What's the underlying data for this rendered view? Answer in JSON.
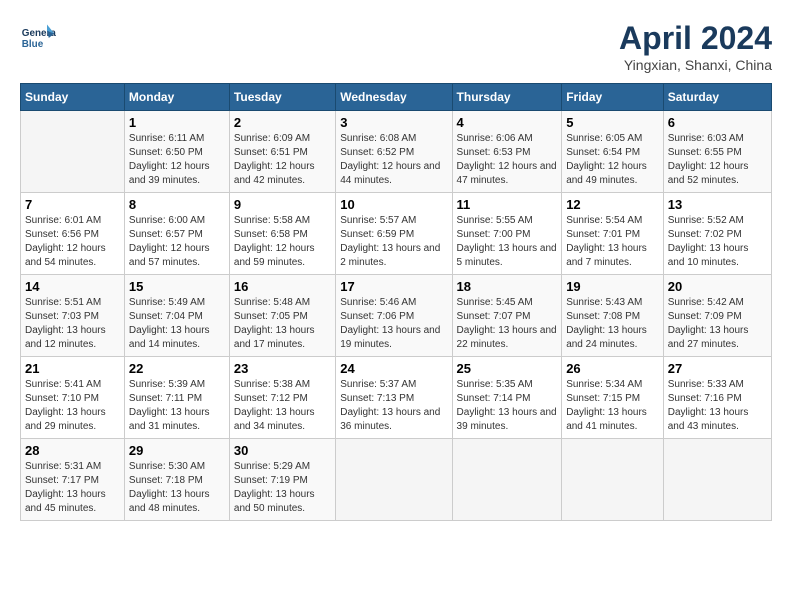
{
  "header": {
    "logo_line1": "General",
    "logo_line2": "Blue",
    "month_title": "April 2024",
    "location": "Yingxian, Shanxi, China"
  },
  "weekdays": [
    "Sunday",
    "Monday",
    "Tuesday",
    "Wednesday",
    "Thursday",
    "Friday",
    "Saturday"
  ],
  "weeks": [
    [
      {
        "day": "",
        "sunrise": "",
        "sunset": "",
        "daylight": ""
      },
      {
        "day": "1",
        "sunrise": "Sunrise: 6:11 AM",
        "sunset": "Sunset: 6:50 PM",
        "daylight": "Daylight: 12 hours and 39 minutes."
      },
      {
        "day": "2",
        "sunrise": "Sunrise: 6:09 AM",
        "sunset": "Sunset: 6:51 PM",
        "daylight": "Daylight: 12 hours and 42 minutes."
      },
      {
        "day": "3",
        "sunrise": "Sunrise: 6:08 AM",
        "sunset": "Sunset: 6:52 PM",
        "daylight": "Daylight: 12 hours and 44 minutes."
      },
      {
        "day": "4",
        "sunrise": "Sunrise: 6:06 AM",
        "sunset": "Sunset: 6:53 PM",
        "daylight": "Daylight: 12 hours and 47 minutes."
      },
      {
        "day": "5",
        "sunrise": "Sunrise: 6:05 AM",
        "sunset": "Sunset: 6:54 PM",
        "daylight": "Daylight: 12 hours and 49 minutes."
      },
      {
        "day": "6",
        "sunrise": "Sunrise: 6:03 AM",
        "sunset": "Sunset: 6:55 PM",
        "daylight": "Daylight: 12 hours and 52 minutes."
      }
    ],
    [
      {
        "day": "7",
        "sunrise": "Sunrise: 6:01 AM",
        "sunset": "Sunset: 6:56 PM",
        "daylight": "Daylight: 12 hours and 54 minutes."
      },
      {
        "day": "8",
        "sunrise": "Sunrise: 6:00 AM",
        "sunset": "Sunset: 6:57 PM",
        "daylight": "Daylight: 12 hours and 57 minutes."
      },
      {
        "day": "9",
        "sunrise": "Sunrise: 5:58 AM",
        "sunset": "Sunset: 6:58 PM",
        "daylight": "Daylight: 12 hours and 59 minutes."
      },
      {
        "day": "10",
        "sunrise": "Sunrise: 5:57 AM",
        "sunset": "Sunset: 6:59 PM",
        "daylight": "Daylight: 13 hours and 2 minutes."
      },
      {
        "day": "11",
        "sunrise": "Sunrise: 5:55 AM",
        "sunset": "Sunset: 7:00 PM",
        "daylight": "Daylight: 13 hours and 5 minutes."
      },
      {
        "day": "12",
        "sunrise": "Sunrise: 5:54 AM",
        "sunset": "Sunset: 7:01 PM",
        "daylight": "Daylight: 13 hours and 7 minutes."
      },
      {
        "day": "13",
        "sunrise": "Sunrise: 5:52 AM",
        "sunset": "Sunset: 7:02 PM",
        "daylight": "Daylight: 13 hours and 10 minutes."
      }
    ],
    [
      {
        "day": "14",
        "sunrise": "Sunrise: 5:51 AM",
        "sunset": "Sunset: 7:03 PM",
        "daylight": "Daylight: 13 hours and 12 minutes."
      },
      {
        "day": "15",
        "sunrise": "Sunrise: 5:49 AM",
        "sunset": "Sunset: 7:04 PM",
        "daylight": "Daylight: 13 hours and 14 minutes."
      },
      {
        "day": "16",
        "sunrise": "Sunrise: 5:48 AM",
        "sunset": "Sunset: 7:05 PM",
        "daylight": "Daylight: 13 hours and 17 minutes."
      },
      {
        "day": "17",
        "sunrise": "Sunrise: 5:46 AM",
        "sunset": "Sunset: 7:06 PM",
        "daylight": "Daylight: 13 hours and 19 minutes."
      },
      {
        "day": "18",
        "sunrise": "Sunrise: 5:45 AM",
        "sunset": "Sunset: 7:07 PM",
        "daylight": "Daylight: 13 hours and 22 minutes."
      },
      {
        "day": "19",
        "sunrise": "Sunrise: 5:43 AM",
        "sunset": "Sunset: 7:08 PM",
        "daylight": "Daylight: 13 hours and 24 minutes."
      },
      {
        "day": "20",
        "sunrise": "Sunrise: 5:42 AM",
        "sunset": "Sunset: 7:09 PM",
        "daylight": "Daylight: 13 hours and 27 minutes."
      }
    ],
    [
      {
        "day": "21",
        "sunrise": "Sunrise: 5:41 AM",
        "sunset": "Sunset: 7:10 PM",
        "daylight": "Daylight: 13 hours and 29 minutes."
      },
      {
        "day": "22",
        "sunrise": "Sunrise: 5:39 AM",
        "sunset": "Sunset: 7:11 PM",
        "daylight": "Daylight: 13 hours and 31 minutes."
      },
      {
        "day": "23",
        "sunrise": "Sunrise: 5:38 AM",
        "sunset": "Sunset: 7:12 PM",
        "daylight": "Daylight: 13 hours and 34 minutes."
      },
      {
        "day": "24",
        "sunrise": "Sunrise: 5:37 AM",
        "sunset": "Sunset: 7:13 PM",
        "daylight": "Daylight: 13 hours and 36 minutes."
      },
      {
        "day": "25",
        "sunrise": "Sunrise: 5:35 AM",
        "sunset": "Sunset: 7:14 PM",
        "daylight": "Daylight: 13 hours and 39 minutes."
      },
      {
        "day": "26",
        "sunrise": "Sunrise: 5:34 AM",
        "sunset": "Sunset: 7:15 PM",
        "daylight": "Daylight: 13 hours and 41 minutes."
      },
      {
        "day": "27",
        "sunrise": "Sunrise: 5:33 AM",
        "sunset": "Sunset: 7:16 PM",
        "daylight": "Daylight: 13 hours and 43 minutes."
      }
    ],
    [
      {
        "day": "28",
        "sunrise": "Sunrise: 5:31 AM",
        "sunset": "Sunset: 7:17 PM",
        "daylight": "Daylight: 13 hours and 45 minutes."
      },
      {
        "day": "29",
        "sunrise": "Sunrise: 5:30 AM",
        "sunset": "Sunset: 7:18 PM",
        "daylight": "Daylight: 13 hours and 48 minutes."
      },
      {
        "day": "30",
        "sunrise": "Sunrise: 5:29 AM",
        "sunset": "Sunset: 7:19 PM",
        "daylight": "Daylight: 13 hours and 50 minutes."
      },
      {
        "day": "",
        "sunrise": "",
        "sunset": "",
        "daylight": ""
      },
      {
        "day": "",
        "sunrise": "",
        "sunset": "",
        "daylight": ""
      },
      {
        "day": "",
        "sunrise": "",
        "sunset": "",
        "daylight": ""
      },
      {
        "day": "",
        "sunrise": "",
        "sunset": "",
        "daylight": ""
      }
    ]
  ]
}
